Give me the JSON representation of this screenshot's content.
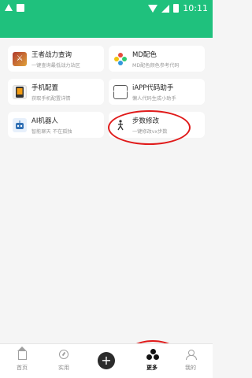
{
  "status_bar": {
    "time": "10:11"
  },
  "tools": [
    {
      "title": "王者战力查询",
      "subtitle": "一键查询最低战力站区",
      "icon": "game-icon"
    },
    {
      "title": "MD配色",
      "subtitle": "MD配色颜色参考代码",
      "icon": "palette-icon"
    },
    {
      "title": "手机配置",
      "subtitle": "获取手机配置详情",
      "icon": "phone-icon"
    },
    {
      "title": "iAPP代码助手",
      "subtitle": "懒人代码生成小助手",
      "icon": "code-icon"
    },
    {
      "title": "AI机器人",
      "subtitle": "智能聊天 不在孤独",
      "icon": "robot-icon"
    },
    {
      "title": "步数修改",
      "subtitle": "一键修改vx步数",
      "icon": "footsteps-icon"
    }
  ],
  "nav": {
    "home": "首页",
    "practical": "实用",
    "add": "+",
    "more": "更多",
    "mine": "我的"
  },
  "colors": {
    "accent": "#1fc17d",
    "annotation": "#e01a1a"
  }
}
